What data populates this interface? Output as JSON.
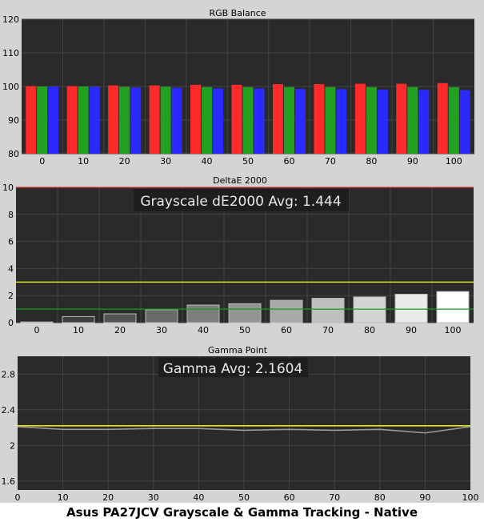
{
  "caption": "Asus PA27JCV Grayscale & Gamma Tracking - Native",
  "colors": {
    "panel_bg": "#d4d4d4",
    "plot_bg": "#2a2a2a",
    "grid": "#444444",
    "red": "#ff2a2a",
    "green": "#22a022",
    "blue": "#2a2aff",
    "yellow": "#e6e600",
    "dark_green": "#1a9a1a",
    "gamma_line": "#999999",
    "limit_red": "#e03030"
  },
  "chart_data": [
    {
      "type": "bar",
      "title": "RGB Balance",
      "categories": [
        "0",
        "10",
        "20",
        "30",
        "40",
        "50",
        "60",
        "70",
        "80",
        "90",
        "100"
      ],
      "series": [
        {
          "color": "red",
          "values": [
            100.1,
            100.1,
            100.3,
            100.3,
            100.5,
            100.5,
            100.7,
            100.7,
            100.8,
            100.8,
            101.0
          ]
        },
        {
          "color": "green",
          "values": [
            100.0,
            100.0,
            99.9,
            99.9,
            99.8,
            99.8,
            99.8,
            99.8,
            99.8,
            99.8,
            99.8
          ]
        },
        {
          "color": "blue",
          "values": [
            100.0,
            99.9,
            99.7,
            99.6,
            99.4,
            99.4,
            99.3,
            99.2,
            99.1,
            99.0,
            98.9
          ]
        }
      ],
      "ylim": [
        80,
        120
      ],
      "yticks": [
        80,
        90,
        100,
        110,
        120
      ]
    },
    {
      "type": "bar",
      "title": "DeltaE 2000",
      "annotation": "Grayscale dE2000 Avg: 1.444",
      "categories": [
        "0",
        "10",
        "20",
        "30",
        "40",
        "50",
        "60",
        "70",
        "80",
        "90",
        "100"
      ],
      "values": [
        0.05,
        0.45,
        0.65,
        0.95,
        1.3,
        1.4,
        1.65,
        1.8,
        1.9,
        2.1,
        2.3
      ],
      "ylim": [
        0,
        10
      ],
      "yticks": [
        0,
        2,
        4,
        6,
        8,
        10
      ],
      "reference_lines": [
        {
          "value": 10,
          "color": "limit_red"
        },
        {
          "value": 3,
          "color": "yellow"
        },
        {
          "value": 1,
          "color": "dark_green"
        }
      ]
    },
    {
      "type": "line",
      "title": "Gamma Point",
      "annotation": "Gamma Avg: 2.1604",
      "x": [
        0,
        10,
        20,
        30,
        40,
        50,
        60,
        70,
        80,
        90,
        100
      ],
      "values": [
        2.21,
        2.18,
        2.18,
        2.19,
        2.19,
        2.17,
        2.18,
        2.17,
        2.18,
        2.14,
        2.21
      ],
      "target": 2.22,
      "xlim": [
        0,
        100
      ],
      "xticks": [
        "0",
        "10",
        "20",
        "30",
        "40",
        "50",
        "60",
        "70",
        "80",
        "90",
        "100"
      ],
      "ylim": [
        1.5,
        3.0
      ],
      "yticks": [
        "1.6",
        "2",
        "2.4",
        "2.8"
      ],
      "ytick_values": [
        1.6,
        2.0,
        2.4,
        2.8
      ]
    }
  ]
}
